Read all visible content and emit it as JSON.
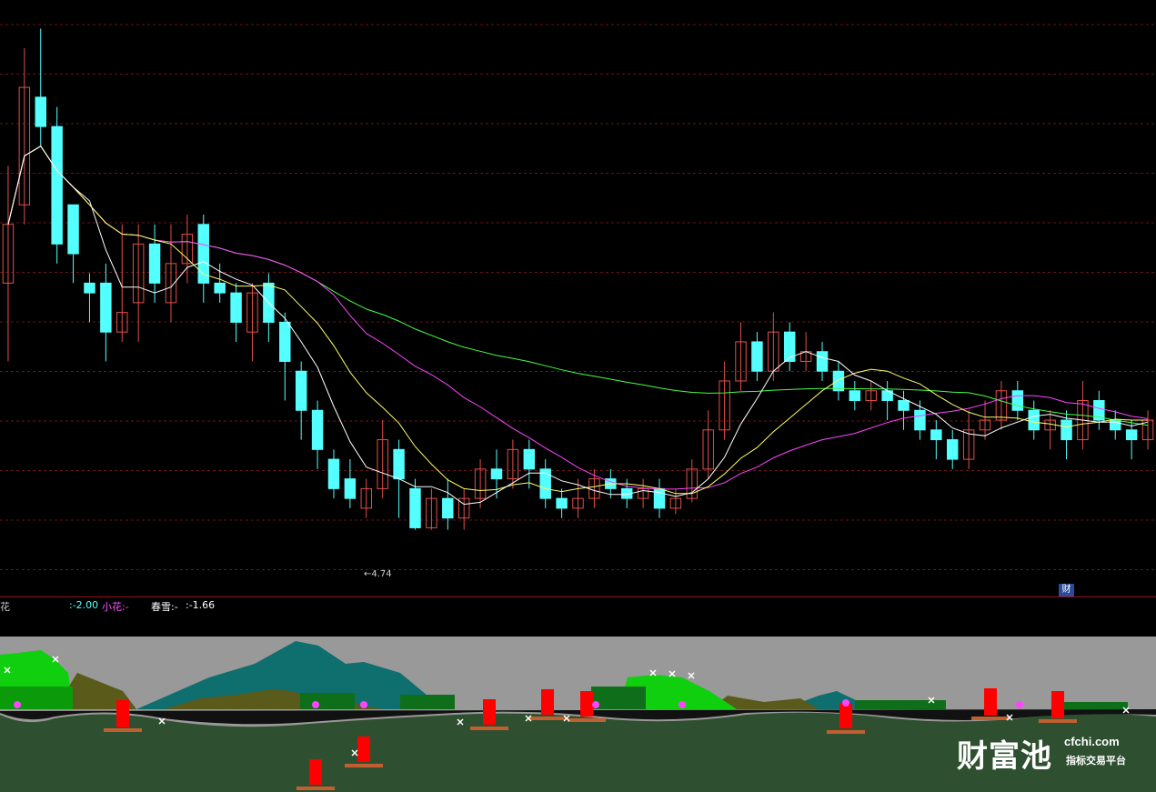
{
  "chart_data": {
    "type": "candlestick",
    "low_label": "←4.74",
    "badge": "财",
    "colors": {
      "up": "#e0504a",
      "down": "#54ffff",
      "ma5": "#ffffff",
      "ma10": "#ffff66",
      "ma20": "#ff44ff",
      "ma60": "#44ff44",
      "grid": "#6b1515"
    },
    "ylim": [
      4.45,
      7.4
    ],
    "candles": [
      [
        6.0,
        6.3,
        5.6,
        6.6
      ],
      [
        6.4,
        7.0,
        6.3,
        7.2
      ],
      [
        6.95,
        6.8,
        6.7,
        7.3
      ],
      [
        6.8,
        6.2,
        6.1,
        6.9
      ],
      [
        6.4,
        6.15,
        6.0,
        6.4
      ],
      [
        6.0,
        5.95,
        5.8,
        6.05
      ],
      [
        6.0,
        5.75,
        5.6,
        6.1
      ],
      [
        5.75,
        5.85,
        5.7,
        6.3
      ],
      [
        5.9,
        6.2,
        5.7,
        6.3
      ],
      [
        6.2,
        6.0,
        5.9,
        6.3
      ],
      [
        5.9,
        6.1,
        5.8,
        6.3
      ],
      [
        6.1,
        6.25,
        6.0,
        6.35
      ],
      [
        6.3,
        6.0,
        5.9,
        6.35
      ],
      [
        6.0,
        5.95,
        5.9,
        6.1
      ],
      [
        5.95,
        5.8,
        5.7,
        6.0
      ],
      [
        5.75,
        5.95,
        5.6,
        6.0
      ],
      [
        6.0,
        5.8,
        5.7,
        6.05
      ],
      [
        5.8,
        5.6,
        5.4,
        5.85
      ],
      [
        5.55,
        5.35,
        5.2,
        5.6
      ],
      [
        5.35,
        5.15,
        5.05,
        5.4
      ],
      [
        5.1,
        4.95,
        4.9,
        5.15
      ],
      [
        5.0,
        4.9,
        4.85,
        5.1
      ],
      [
        4.85,
        4.95,
        4.8,
        5.0
      ],
      [
        4.95,
        5.2,
        4.9,
        5.3
      ],
      [
        5.15,
        5.0,
        4.8,
        5.2
      ],
      [
        4.95,
        4.75,
        4.74,
        5.0
      ],
      [
        4.75,
        4.9,
        4.74,
        4.95
      ],
      [
        4.9,
        4.8,
        4.74,
        5.0
      ],
      [
        4.8,
        4.9,
        4.74,
        4.95
      ],
      [
        4.9,
        5.05,
        4.85,
        5.1
      ],
      [
        5.05,
        5.0,
        4.9,
        5.15
      ],
      [
        5.0,
        5.15,
        4.95,
        5.2
      ],
      [
        5.15,
        5.05,
        4.95,
        5.2
      ],
      [
        5.05,
        4.9,
        4.85,
        5.1
      ],
      [
        4.9,
        4.85,
        4.8,
        4.95
      ],
      [
        4.85,
        4.9,
        4.8,
        5.0
      ],
      [
        4.9,
        5.0,
        4.85,
        5.05
      ],
      [
        5.0,
        4.95,
        4.9,
        5.05
      ],
      [
        4.95,
        4.9,
        4.85,
        5.0
      ],
      [
        4.9,
        4.95,
        4.85,
        5.0
      ],
      [
        4.95,
        4.85,
        4.8,
        5.0
      ],
      [
        4.85,
        4.9,
        4.82,
        4.95
      ],
      [
        4.9,
        5.05,
        4.88,
        5.1
      ],
      [
        5.05,
        5.25,
        5.0,
        5.35
      ],
      [
        5.25,
        5.5,
        5.2,
        5.6
      ],
      [
        5.5,
        5.7,
        5.45,
        5.8
      ],
      [
        5.7,
        5.55,
        5.5,
        5.75
      ],
      [
        5.55,
        5.75,
        5.5,
        5.85
      ],
      [
        5.75,
        5.6,
        5.55,
        5.8
      ],
      [
        5.6,
        5.65,
        5.55,
        5.75
      ],
      [
        5.65,
        5.55,
        5.5,
        5.7
      ],
      [
        5.55,
        5.45,
        5.4,
        5.6
      ],
      [
        5.45,
        5.4,
        5.35,
        5.5
      ],
      [
        5.4,
        5.45,
        5.35,
        5.5
      ],
      [
        5.45,
        5.4,
        5.3,
        5.5
      ],
      [
        5.4,
        5.35,
        5.25,
        5.45
      ],
      [
        5.35,
        5.25,
        5.2,
        5.4
      ],
      [
        5.25,
        5.2,
        5.1,
        5.3
      ],
      [
        5.2,
        5.1,
        5.05,
        5.25
      ],
      [
        5.1,
        5.25,
        5.05,
        5.35
      ],
      [
        5.25,
        5.3,
        5.2,
        5.4
      ],
      [
        5.3,
        5.45,
        5.25,
        5.5
      ],
      [
        5.45,
        5.35,
        5.3,
        5.5
      ],
      [
        5.35,
        5.25,
        5.2,
        5.4
      ],
      [
        5.25,
        5.3,
        5.15,
        5.35
      ],
      [
        5.3,
        5.2,
        5.1,
        5.35
      ],
      [
        5.2,
        5.4,
        5.15,
        5.5
      ],
      [
        5.4,
        5.3,
        5.25,
        5.45
      ],
      [
        5.3,
        5.25,
        5.2,
        5.35
      ],
      [
        5.25,
        5.2,
        5.1,
        5.3
      ],
      [
        5.2,
        5.3,
        5.15,
        5.35
      ]
    ]
  },
  "indicator": {
    "name_tail": "花",
    "value1": ":-2.00",
    "xiaohua_label": "小花:-",
    "chunxue_label": "春雪:-",
    "chunxue_value": ":-1.66"
  },
  "watermark": {
    "cn": "财富池",
    "domain": "cfchi.com",
    "sub": "指标交易平台"
  }
}
